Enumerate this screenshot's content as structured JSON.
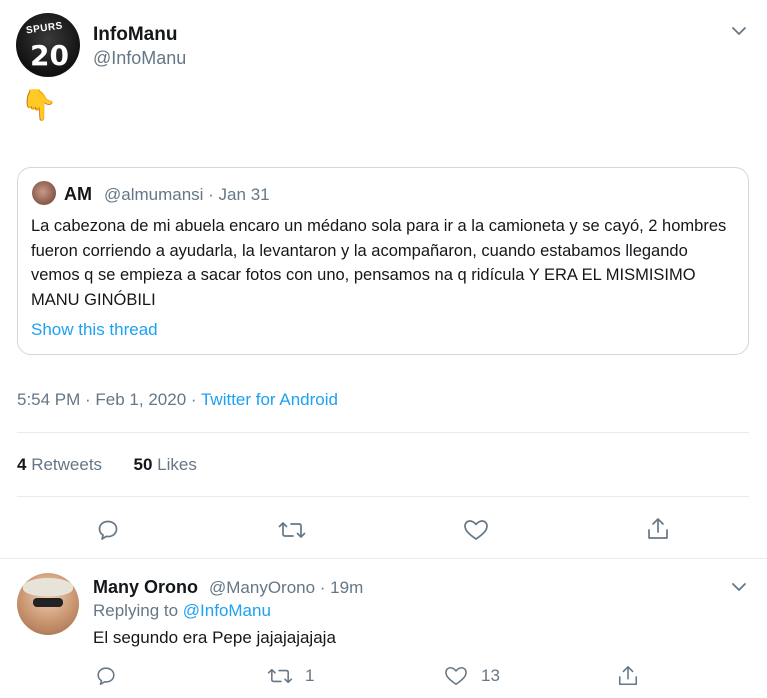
{
  "tweet": {
    "author_name": "InfoManu",
    "author_handle": "@InfoManu",
    "avatar_text_top": "SPURS",
    "avatar_text_number": "20",
    "body_emoji": "👇",
    "timestamp": "5:54 PM · Feb 1, 2020 · ",
    "source": "Twitter for Android",
    "retweets_count": "4",
    "retweets_label": " Retweets",
    "likes_count": "50",
    "likes_label": " Likes"
  },
  "quoted": {
    "author_name": "AM",
    "author_handle": "@almumansi · Jan 31",
    "text": "La cabezona de mi abuela encaro un médano sola para  ir a la camioneta y se cayó, 2 hombres fueron corriendo a ayudarla, la levantaron y la acompañaron, cuando estabamos llegando vemos q se empieza a sacar fotos con uno, pensamos na q ridícula Y ERA EL MISMISIMO MANU GINÓBILI",
    "show_thread": "Show this thread"
  },
  "reply": {
    "author_name": "Many Orono",
    "author_handle": "@ManyOrono · 19m",
    "replying_prefix": "Replying to ",
    "replying_handle": "@InfoManu",
    "text": "El segundo era Pepe jajajajajaja",
    "retweets_count": "1",
    "likes_count": "13"
  },
  "icons": {
    "reply": "reply-icon",
    "retweet": "retweet-icon",
    "like": "heart-icon",
    "share": "share-icon",
    "more": "chevron-down-icon"
  },
  "colors": {
    "accent": "#1da1f2",
    "secondary_text": "#657786",
    "border": "#cfd9de"
  }
}
